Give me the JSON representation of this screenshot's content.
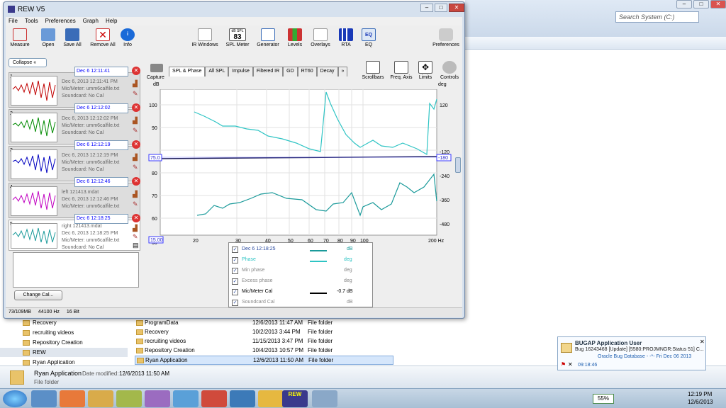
{
  "explorer": {
    "search_placeholder": "Search System (C:)",
    "nav_items": [
      "Recovery",
      "recruiting videos",
      "Repository Creation",
      "REW",
      "Ryan Application"
    ],
    "files": [
      {
        "name": "ProgramData",
        "date": "12/6/2013 11:47 AM",
        "type": "File folder"
      },
      {
        "name": "Recovery",
        "date": "10/2/2013 3:44 PM",
        "type": "File folder"
      },
      {
        "name": "recruiting videos",
        "date": "11/15/2013 3:47 PM",
        "type": "File folder"
      },
      {
        "name": "Repository Creation",
        "date": "10/4/2013 10:57 PM",
        "type": "File folder"
      },
      {
        "name": "Ryan Application",
        "date": "12/6/2013 11:50 AM",
        "type": "File folder"
      }
    ],
    "details": {
      "name": "Ryan Application",
      "modified_label": "Date modified:",
      "modified": "12/6/2013 11:50 AM",
      "type": "File folder"
    }
  },
  "rew": {
    "title": "REW V5",
    "menu": [
      "File",
      "Tools",
      "Preferences",
      "Graph",
      "Help"
    ],
    "toolbar": [
      "Measure",
      "Open",
      "Save All",
      "Remove All",
      "Info",
      "IR Windows",
      "SPL Meter",
      "Generator",
      "Levels",
      "Overlays",
      "RTA",
      "EQ",
      "Preferences"
    ],
    "spl_value": "83",
    "spl_label": "dB SPL",
    "collapse": "Collapse",
    "measurements": [
      {
        "num": "1",
        "name": "Dec 6 12:11:41",
        "line1": "Dec 6, 2013 12:11:41 PM",
        "line2": "Mic/Meter: umm6calfile.txt",
        "line3": "Soundcard: No Cal",
        "color": "#c00000"
      },
      {
        "num": "2",
        "name": "Dec 6 12:12:02",
        "line1": "Dec 6, 2013 12:12:02 PM",
        "line2": "Mic/Meter: umm6calfile.txt",
        "line3": "Soundcard: No Cal",
        "color": "#008a00"
      },
      {
        "num": "3",
        "name": "Dec 6 12:12:19",
        "line1": "Dec 6, 2013 12:12:19 PM",
        "line2": "Mic/Meter: umm6calfile.txt",
        "line3": "Soundcard: No Cal",
        "color": "#0000c0"
      },
      {
        "num": "4",
        "name": "Dec 6 12:12:46",
        "line1": "left 121413.mdat",
        "line2": "Dec 6, 2013 12:12:46 PM",
        "line3": "Mic/Meter: umm6calfile.txt",
        "color": "#c000c0"
      },
      {
        "num": "5",
        "name": "Dec 6 12:18:25",
        "line1": "right 121413.mdat",
        "line2": "Dec 6, 2013 12:18:25 PM",
        "line3": "Mic/Meter: umm6calfile.txt",
        "line4": "Soundcard: No Cal",
        "color": "#1a9a9a"
      }
    ],
    "change_cal": "Change Cal...",
    "capture": "Capture",
    "tabs": [
      "SPL & Phase",
      "All SPL",
      "Impulse",
      "Filtered IR",
      "GD",
      "RT60",
      "Decay",
      "»"
    ],
    "right_tools": [
      "Scrollbars",
      "Freq. Axis",
      "Limits",
      "Controls"
    ],
    "graph": {
      "left_unit": "dB",
      "right_unit": "deg",
      "y_ticks": [
        "100",
        "90",
        "80",
        "70",
        "60",
        "50"
      ],
      "right_ticks": [
        "120",
        "-120",
        "-240",
        "-360",
        "-480"
      ],
      "marker_left": "75.0",
      "marker_right": "-180",
      "marker_bottom": "15.00",
      "x_ticks": [
        "20",
        "30",
        "40",
        "50",
        "60",
        "70",
        "80",
        "90",
        "100",
        "200 Hz"
      ]
    },
    "legend": [
      {
        "checked": true,
        "label": "Dec 6 12:18:25",
        "unit": "dB",
        "color": "#1a9a9a",
        "line": true
      },
      {
        "checked": true,
        "label": "Phase",
        "unit": "deg",
        "color": "#2ec4c4",
        "line": true
      },
      {
        "checked": true,
        "label": "Min phase",
        "unit": "deg",
        "color": "#888888",
        "line": false
      },
      {
        "checked": true,
        "label": "Excess phase",
        "unit": "deg",
        "color": "#888888",
        "line": false
      },
      {
        "checked": true,
        "label": "Mic/Meter Cal",
        "value": "-0.7 dB",
        "color": "#000000",
        "line": true
      },
      {
        "checked": true,
        "label": "Soundcard Cal",
        "unit": "dB",
        "color": "#888888",
        "line": false
      }
    ],
    "status": {
      "memory": "73/109MB",
      "rate": "44100 Hz",
      "bits": "16 Bit"
    }
  },
  "notification": {
    "title": "BUGAP Application User",
    "body": "Bug 16243468 [Update] [5580:PROJMNGR:Status 51] C...",
    "source": "Oracle Bug Database - -*- Fri Dec 06 2013",
    "time": "09:18:46"
  },
  "taskbar": {
    "battery": "55%",
    "time": "12:19 PM",
    "date": "12/6/2013"
  }
}
